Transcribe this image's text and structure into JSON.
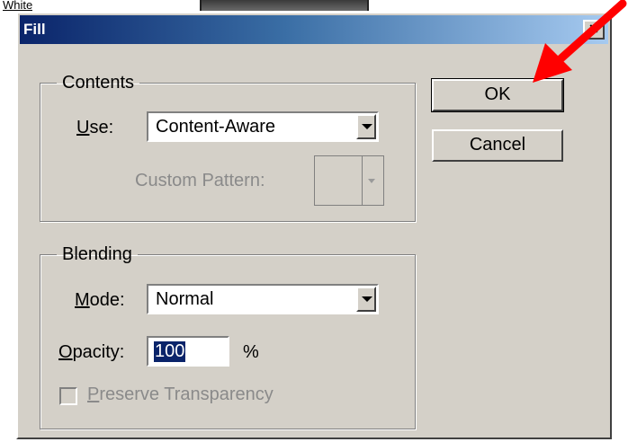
{
  "background": {
    "label": "White"
  },
  "dialog": {
    "title": "Fill",
    "close_label": "×",
    "buttons": {
      "ok": "OK",
      "cancel": "Cancel"
    },
    "contents": {
      "legend": "Contents",
      "use_label_accel": "U",
      "use_label_rest": "se:",
      "use_value": "Content-Aware",
      "custom_pattern_label": "Custom Pattern:"
    },
    "blending": {
      "legend": "Blending",
      "mode_label_accel": "M",
      "mode_label_rest": "ode:",
      "mode_value": "Normal",
      "opacity_label_accel": "O",
      "opacity_label_rest": "pacity:",
      "opacity_value": "100",
      "opacity_unit": "%",
      "preserve_accel": "P",
      "preserve_rest": "reserve Transparency"
    }
  },
  "colors": {
    "titlebar_start": "#0a246a",
    "titlebar_end": "#a6caf0",
    "face": "#d4d0c8",
    "annotation_arrow": "#ff0000"
  }
}
